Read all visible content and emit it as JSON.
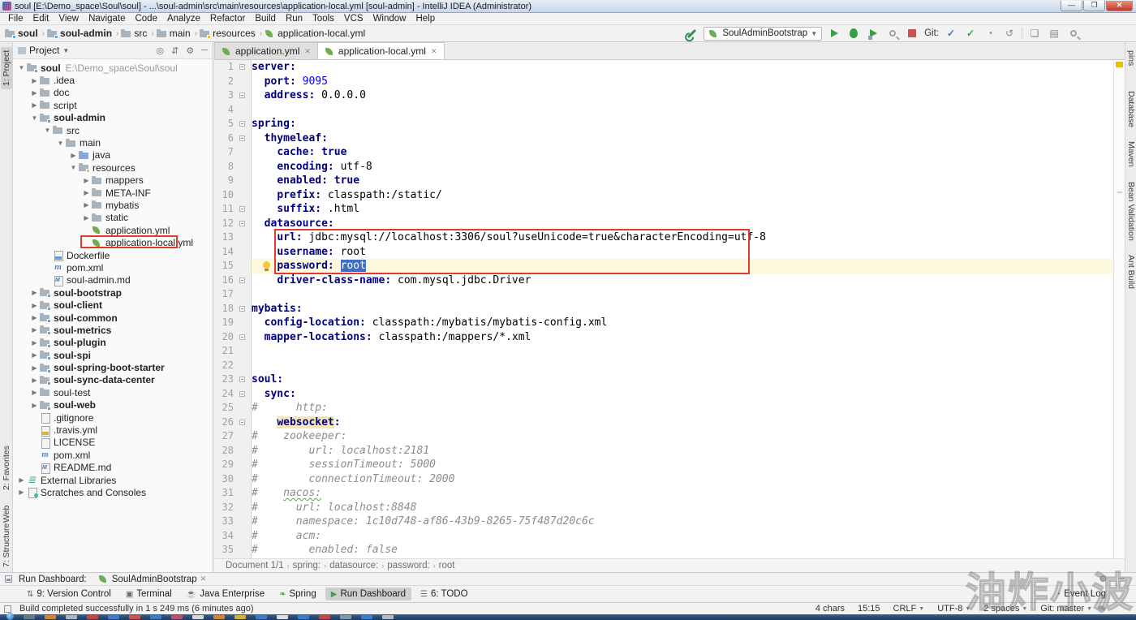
{
  "window": {
    "title": "soul [E:\\Demo_space\\Soul\\soul] - ...\\soul-admin\\src\\main\\resources\\application-local.yml [soul-admin] - IntelliJ IDEA (Administrator)",
    "controls": {
      "minimize": "—",
      "maximize": "❐",
      "close": "✕"
    }
  },
  "menu": {
    "items": [
      "File",
      "Edit",
      "View",
      "Navigate",
      "Code",
      "Analyze",
      "Refactor",
      "Build",
      "Run",
      "Tools",
      "VCS",
      "Window",
      "Help"
    ]
  },
  "navbar": {
    "breadcrumbs": [
      {
        "label": "soul",
        "icon": "module",
        "bold": true
      },
      {
        "label": "soul-admin",
        "icon": "module",
        "bold": true
      },
      {
        "label": "src",
        "icon": "folder",
        "bold": false
      },
      {
        "label": "main",
        "icon": "folder",
        "bold": false
      },
      {
        "label": "resources",
        "icon": "resfolder",
        "bold": false
      },
      {
        "label": "application-local.yml",
        "icon": "spring",
        "bold": false
      }
    ],
    "run_config": "SoulAdminBootstrap",
    "git_label": "Git:"
  },
  "left_stripe": {
    "top": [
      {
        "label": "1: Project",
        "active": true
      }
    ],
    "bottom": [
      {
        "label": "2: Favorites"
      },
      {
        "label": "Web"
      },
      {
        "label": "7: Structure"
      }
    ]
  },
  "right_stripe": [
    {
      "label": "pins"
    },
    {
      "label": "Database"
    },
    {
      "label": "Maven"
    },
    {
      "label": "Bean Validation"
    },
    {
      "label": "Ant Build"
    }
  ],
  "project_panel": {
    "header": {
      "title": "Project"
    },
    "tree": [
      {
        "indent": 0,
        "arrow": "v",
        "icon": "module",
        "label": "soul",
        "bold": true,
        "sub": "E:\\Demo_space\\Soul\\soul"
      },
      {
        "indent": 1,
        "arrow": ">",
        "icon": "folder",
        "label": ".idea"
      },
      {
        "indent": 1,
        "arrow": ">",
        "icon": "folder",
        "label": "doc"
      },
      {
        "indent": 1,
        "arrow": ">",
        "icon": "folder",
        "label": "script"
      },
      {
        "indent": 1,
        "arrow": "v",
        "icon": "module",
        "label": "soul-admin",
        "bold": true
      },
      {
        "indent": 2,
        "arrow": "v",
        "icon": "folder",
        "label": "src"
      },
      {
        "indent": 3,
        "arrow": "v",
        "icon": "folder",
        "label": "main"
      },
      {
        "indent": 4,
        "arrow": ">",
        "icon": "srcfolder",
        "label": "java"
      },
      {
        "indent": 4,
        "arrow": "v",
        "icon": "resfolder",
        "label": "resources"
      },
      {
        "indent": 5,
        "arrow": ">",
        "icon": "folder",
        "label": "mappers"
      },
      {
        "indent": 5,
        "arrow": ">",
        "icon": "folder",
        "label": "META-INF"
      },
      {
        "indent": 5,
        "arrow": ">",
        "icon": "folder",
        "label": "mybatis"
      },
      {
        "indent": 5,
        "arrow": ">",
        "icon": "folder",
        "label": "static"
      },
      {
        "indent": 5,
        "arrow": "",
        "icon": "spring",
        "label": "application.yml"
      },
      {
        "indent": 5,
        "arrow": "",
        "icon": "spring",
        "label": "application-local.yml",
        "annotated": true
      },
      {
        "indent": 2,
        "arrow": "",
        "icon": "docker",
        "label": "Dockerfile"
      },
      {
        "indent": 2,
        "arrow": "",
        "icon": "maven",
        "label": "pom.xml"
      },
      {
        "indent": 2,
        "arrow": "",
        "icon": "md",
        "label": "soul-admin.md"
      },
      {
        "indent": 1,
        "arrow": ">",
        "icon": "module",
        "label": "soul-bootstrap",
        "bold": true
      },
      {
        "indent": 1,
        "arrow": ">",
        "icon": "module",
        "label": "soul-client",
        "bold": true
      },
      {
        "indent": 1,
        "arrow": ">",
        "icon": "module",
        "label": "soul-common",
        "bold": true
      },
      {
        "indent": 1,
        "arrow": ">",
        "icon": "module",
        "label": "soul-metrics",
        "bold": true
      },
      {
        "indent": 1,
        "arrow": ">",
        "icon": "module",
        "label": "soul-plugin",
        "bold": true
      },
      {
        "indent": 1,
        "arrow": ">",
        "icon": "module",
        "label": "soul-spi",
        "bold": true
      },
      {
        "indent": 1,
        "arrow": ">",
        "icon": "module",
        "label": "soul-spring-boot-starter",
        "bold": true
      },
      {
        "indent": 1,
        "arrow": ">",
        "icon": "module",
        "label": "soul-sync-data-center",
        "bold": true
      },
      {
        "indent": 1,
        "arrow": ">",
        "icon": "folder",
        "label": "soul-test"
      },
      {
        "indent": 1,
        "arrow": ">",
        "icon": "module",
        "label": "soul-web",
        "bold": true
      },
      {
        "indent": 1,
        "arrow": "",
        "icon": "doc",
        "label": ".gitignore"
      },
      {
        "indent": 1,
        "arrow": "",
        "icon": "yml",
        "label": ".travis.yml"
      },
      {
        "indent": 1,
        "arrow": "",
        "icon": "doc",
        "label": "LICENSE"
      },
      {
        "indent": 1,
        "arrow": "",
        "icon": "maven",
        "label": "pom.xml"
      },
      {
        "indent": 1,
        "arrow": "",
        "icon": "md",
        "label": "README.md"
      },
      {
        "indent": 0,
        "arrow": ">",
        "icon": "lib",
        "label": "External Libraries"
      },
      {
        "indent": 0,
        "arrow": ">",
        "icon": "scratch",
        "label": "Scratches and Consoles"
      }
    ]
  },
  "editor": {
    "tabs": [
      {
        "label": "application.yml",
        "active": false
      },
      {
        "label": "application-local.yml",
        "active": true
      }
    ],
    "fold_lines": [
      1,
      3,
      5,
      6,
      11,
      12,
      16,
      18,
      20,
      23,
      24,
      26
    ],
    "bulb_line": 15,
    "lines": [
      {
        "n": 1,
        "segs": [
          [
            "k",
            "server:"
          ]
        ]
      },
      {
        "n": 2,
        "segs": [
          [
            "p",
            "  "
          ],
          [
            "k",
            "port:"
          ],
          [
            "p",
            " "
          ],
          [
            "n",
            "9095"
          ]
        ]
      },
      {
        "n": 3,
        "segs": [
          [
            "p",
            "  "
          ],
          [
            "k",
            "address:"
          ],
          [
            "p",
            " 0.0.0.0"
          ]
        ]
      },
      {
        "n": 4,
        "segs": []
      },
      {
        "n": 5,
        "segs": [
          [
            "k",
            "spring:"
          ]
        ]
      },
      {
        "n": 6,
        "segs": [
          [
            "p",
            "  "
          ],
          [
            "k",
            "thymeleaf:"
          ]
        ]
      },
      {
        "n": 7,
        "segs": [
          [
            "p",
            "    "
          ],
          [
            "k",
            "cache:"
          ],
          [
            "p",
            " "
          ],
          [
            "b",
            "true"
          ]
        ]
      },
      {
        "n": 8,
        "segs": [
          [
            "p",
            "    "
          ],
          [
            "k",
            "encoding:"
          ],
          [
            "p",
            " utf-8"
          ]
        ]
      },
      {
        "n": 9,
        "segs": [
          [
            "p",
            "    "
          ],
          [
            "k",
            "enabled:"
          ],
          [
            "p",
            " "
          ],
          [
            "b",
            "true"
          ]
        ]
      },
      {
        "n": 10,
        "segs": [
          [
            "p",
            "    "
          ],
          [
            "k",
            "prefix:"
          ],
          [
            "p",
            " classpath:/static/"
          ]
        ]
      },
      {
        "n": 11,
        "segs": [
          [
            "p",
            "    "
          ],
          [
            "k",
            "suffix:"
          ],
          [
            "p",
            " .html"
          ]
        ]
      },
      {
        "n": 12,
        "segs": [
          [
            "p",
            "  "
          ],
          [
            "k",
            "datasource:"
          ]
        ]
      },
      {
        "n": 13,
        "segs": [
          [
            "p",
            "    "
          ],
          [
            "k",
            "url:"
          ],
          [
            "p",
            " jdbc:mysql://localhost:3306/soul?useUnicode=true&characterEncoding=utf-8"
          ]
        ]
      },
      {
        "n": 14,
        "segs": [
          [
            "p",
            "    "
          ],
          [
            "k",
            "username:"
          ],
          [
            "p",
            " root"
          ]
        ]
      },
      {
        "n": 15,
        "segs": [
          [
            "p",
            "    "
          ],
          [
            "k",
            "password:"
          ],
          [
            "p",
            " "
          ],
          [
            "sel",
            "root"
          ]
        ],
        "current": true
      },
      {
        "n": 16,
        "segs": [
          [
            "p",
            "    "
          ],
          [
            "k",
            "driver-class-name:"
          ],
          [
            "p",
            " com.mysql.jdbc.Driver"
          ]
        ]
      },
      {
        "n": 17,
        "segs": []
      },
      {
        "n": 18,
        "segs": [
          [
            "k",
            "mybatis:"
          ]
        ]
      },
      {
        "n": 19,
        "segs": [
          [
            "p",
            "  "
          ],
          [
            "k",
            "config-location:"
          ],
          [
            "p",
            " classpath:/mybatis/mybatis-config.xml"
          ]
        ]
      },
      {
        "n": 20,
        "segs": [
          [
            "p",
            "  "
          ],
          [
            "k",
            "mapper-locations:"
          ],
          [
            "p",
            " classpath:/mappers/*.xml"
          ]
        ]
      },
      {
        "n": 21,
        "segs": []
      },
      {
        "n": 22,
        "segs": []
      },
      {
        "n": 23,
        "segs": [
          [
            "k",
            "soul:"
          ]
        ]
      },
      {
        "n": 24,
        "segs": [
          [
            "p",
            "  "
          ],
          [
            "k",
            "sync:"
          ]
        ]
      },
      {
        "n": 25,
        "segs": [
          [
            "c",
            "#      http:"
          ]
        ]
      },
      {
        "n": 26,
        "segs": [
          [
            "p",
            "    "
          ],
          [
            "kh",
            "websocket"
          ],
          [
            "k",
            ":"
          ]
        ]
      },
      {
        "n": 27,
        "segs": [
          [
            "c",
            "#    zookeeper:"
          ]
        ]
      },
      {
        "n": 28,
        "segs": [
          [
            "c",
            "#        url: localhost:2181"
          ]
        ]
      },
      {
        "n": 29,
        "segs": [
          [
            "c",
            "#        sessionTimeout: 5000"
          ]
        ]
      },
      {
        "n": 30,
        "segs": [
          [
            "c",
            "#        connectionTimeout: 2000"
          ]
        ]
      },
      {
        "n": 31,
        "segs": [
          [
            "c",
            "#    "
          ],
          [
            "cw",
            "nacos:"
          ]
        ]
      },
      {
        "n": 32,
        "segs": [
          [
            "c",
            "#      url: localhost:8848"
          ]
        ]
      },
      {
        "n": 33,
        "segs": [
          [
            "c",
            "#      namespace: 1c10d748-af86-43b9-8265-75f487d20c6c"
          ]
        ]
      },
      {
        "n": 34,
        "segs": [
          [
            "c",
            "#      acm:"
          ]
        ]
      },
      {
        "n": 35,
        "segs": [
          [
            "c",
            "#        enabled: false"
          ]
        ]
      }
    ],
    "breadcrumb": [
      "Document 1/1",
      "spring:",
      "datasource:",
      "password:",
      "root"
    ]
  },
  "run_dashboard": {
    "label": "Run Dashboard:",
    "tab": "SoulAdminBootstrap"
  },
  "toolwindow_bar": {
    "left": [
      {
        "label": "9: Version Control",
        "glyph": "⇅",
        "active": false
      },
      {
        "label": "Terminal",
        "glyph": "▣",
        "active": false
      },
      {
        "label": "Java Enterprise",
        "glyph": "☕",
        "active": false
      },
      {
        "label": "Spring",
        "glyph": "❧",
        "active": false,
        "green": true
      },
      {
        "label": "Run Dashboard",
        "glyph": "▶",
        "active": true,
        "green": true
      },
      {
        "label": "6: TODO",
        "glyph": "☰",
        "active": false
      }
    ],
    "right": [
      {
        "label": "Event Log",
        "glyph": "◔"
      }
    ]
  },
  "status_bar": {
    "message": "Build completed successfully in 1 s 249 ms (6 minutes ago)",
    "right": [
      {
        "label": "4 chars",
        "caret": false
      },
      {
        "label": "15:15",
        "caret": false
      },
      {
        "label": "CRLF",
        "caret": true
      },
      {
        "label": "UTF-8",
        "caret": true
      },
      {
        "label": "2 spaces",
        "caret": true
      },
      {
        "label": "Git: master",
        "caret": true
      }
    ]
  },
  "taskbar": {
    "icons": [
      "#6b7c8c",
      "#e2893b",
      "#b9c2cc",
      "#cf4a3f",
      "#3f7fd2",
      "#d9544f",
      "#3f7fd2",
      "#c94f6d",
      "#e8e8e8",
      "#e2893b",
      "#e3b93f",
      "#3f7fd2",
      "#f0f0f0",
      "#3f7fd2",
      "#cf4a3f",
      "#8aa0b5",
      "#3f7fd2",
      "#c0c8d0"
    ]
  },
  "watermark": {
    "text": "油炸小波"
  }
}
